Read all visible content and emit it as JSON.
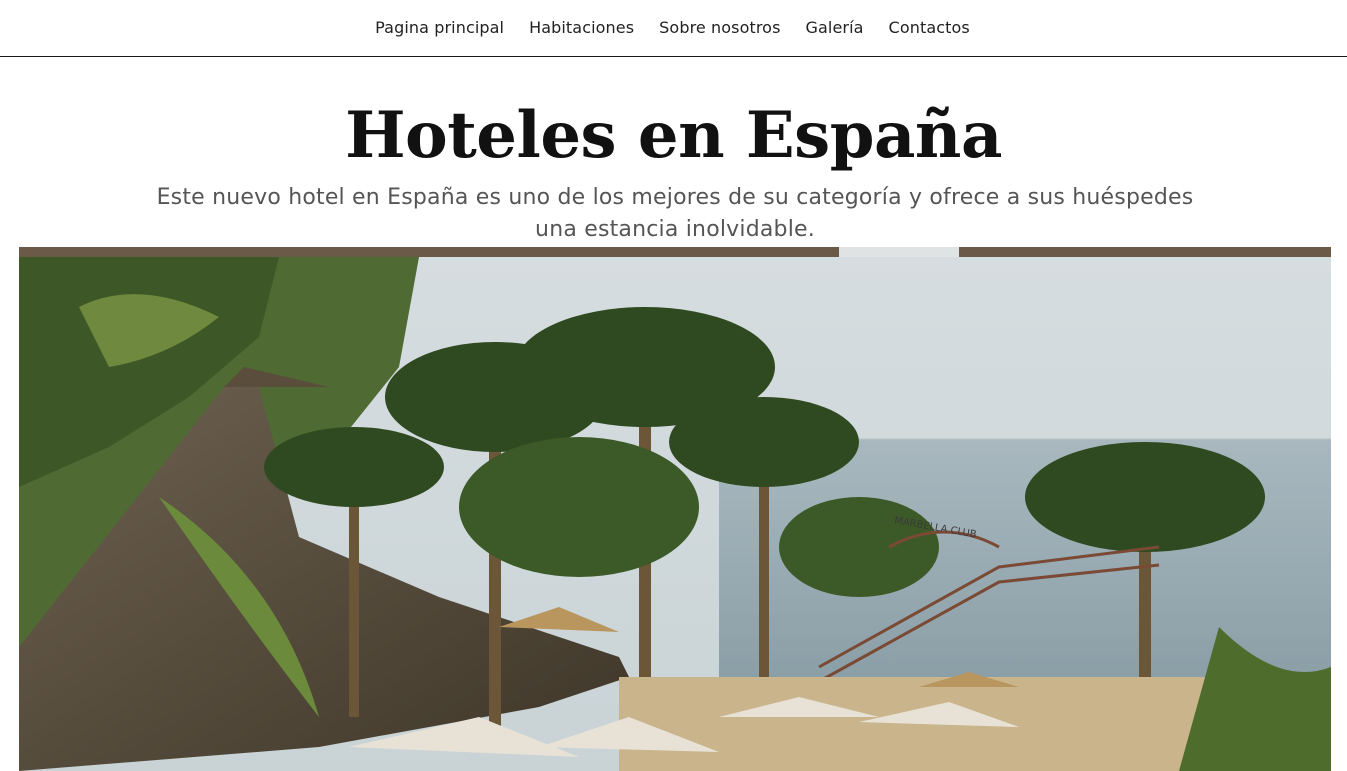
{
  "nav": {
    "items": [
      {
        "label": "Pagina principal"
      },
      {
        "label": "Habitaciones"
      },
      {
        "label": "Sobre nosotros"
      },
      {
        "label": "Galería"
      },
      {
        "label": "Contactos"
      }
    ]
  },
  "hero": {
    "title": "Hoteles en España",
    "subtitle": "Este nuevo hotel en España es uno de los mejores de su categoría y ofrece a sus huéspedes una estancia inolvidable.",
    "image_sign_text": "MARBELLA CLUB"
  }
}
